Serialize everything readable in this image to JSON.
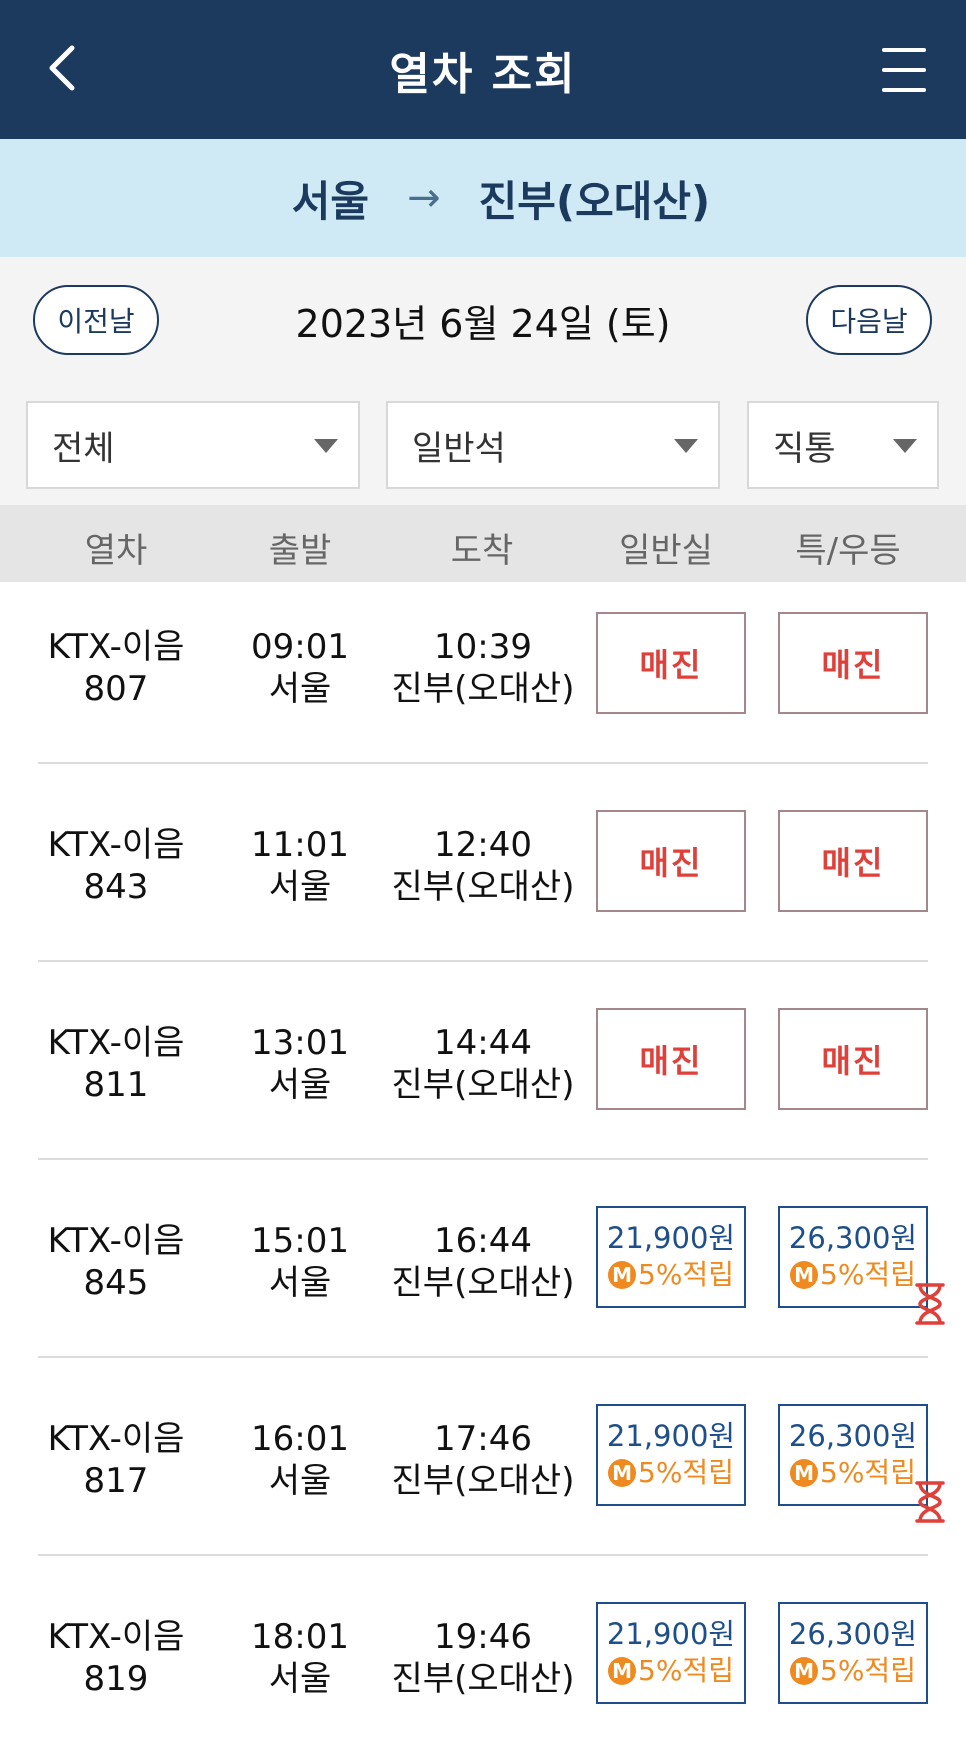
{
  "header": {
    "title": "열차 조회",
    "back_icon": "chevron-left-icon",
    "menu_icon": "hamburger-menu-icon"
  },
  "route": {
    "from": "서울",
    "arrow": "→",
    "to": "진부(오대산)"
  },
  "date": {
    "prev_label": "이전날",
    "text": "2023년 6월 24일 (토)",
    "next_label": "다음날"
  },
  "filters": [
    {
      "value": "전체"
    },
    {
      "value": "일반석"
    },
    {
      "value": "직통"
    }
  ],
  "columns": [
    "열차",
    "출발",
    "도착",
    "일반실",
    "특/우등"
  ],
  "colors": {
    "header_bg": "#1b3a5e",
    "route_bg": "#cfeaf4",
    "soldout": "#e0403a",
    "price": "#1f4f8a",
    "mileage": "#ee8a1f"
  },
  "rows": [
    {
      "train": "KTX-이음",
      "number": "807",
      "dep_time": "09:01",
      "dep_station": "서울",
      "arr_time": "10:39",
      "arr_station": "진부(오대산)",
      "general": {
        "status": "매진"
      },
      "special": {
        "status": "매진"
      }
    },
    {
      "train": "KTX-이음",
      "number": "843",
      "dep_time": "11:01",
      "dep_station": "서울",
      "arr_time": "12:40",
      "arr_station": "진부(오대산)",
      "general": {
        "status": "매진"
      },
      "special": {
        "status": "매진"
      }
    },
    {
      "train": "KTX-이음",
      "number": "811",
      "dep_time": "13:01",
      "dep_station": "서울",
      "arr_time": "14:44",
      "arr_station": "진부(오대산)",
      "general": {
        "status": "매진"
      },
      "special": {
        "status": "매진"
      }
    },
    {
      "train": "KTX-이음",
      "number": "845",
      "dep_time": "15:01",
      "dep_station": "서울",
      "arr_time": "16:44",
      "arr_station": "진부(오대산)",
      "general": {
        "price": "21,900원",
        "mileage": "5%적립"
      },
      "special": {
        "price": "26,300원",
        "mileage": "5%적립",
        "waitlist": true
      }
    },
    {
      "train": "KTX-이음",
      "number": "817",
      "dep_time": "16:01",
      "dep_station": "서울",
      "arr_time": "17:46",
      "arr_station": "진부(오대산)",
      "general": {
        "price": "21,900원",
        "mileage": "5%적립"
      },
      "special": {
        "price": "26,300원",
        "mileage": "5%적립",
        "waitlist": true
      }
    },
    {
      "train": "KTX-이음",
      "number": "819",
      "dep_time": "18:01",
      "dep_station": "서울",
      "arr_time": "19:46",
      "arr_station": "진부(오대산)",
      "general": {
        "price": "21,900원",
        "mileage": "5%적립"
      },
      "special": {
        "price": "26,300원",
        "mileage": "5%적립"
      }
    }
  ],
  "mileage_badge": "M"
}
